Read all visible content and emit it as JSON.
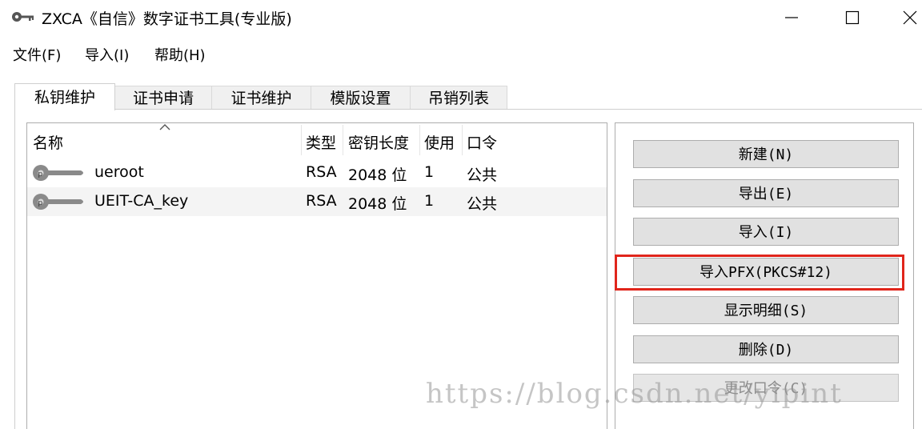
{
  "window": {
    "title": "ZXCA《自信》数字证书工具(专业版)",
    "icon": "key-icon"
  },
  "menu": [
    {
      "label": "文件(F)"
    },
    {
      "label": "导入(I)"
    },
    {
      "label": "帮助(H)"
    }
  ],
  "tabs": [
    {
      "label": "私钥维护",
      "active": true
    },
    {
      "label": "证书申请",
      "active": false
    },
    {
      "label": "证书维护",
      "active": false
    },
    {
      "label": "模版设置",
      "active": false
    },
    {
      "label": "吊销列表",
      "active": false
    }
  ],
  "list": {
    "columns": [
      "名称",
      "类型",
      "密钥长度",
      "使用",
      "口令"
    ],
    "rows": [
      {
        "name": "ueroot",
        "type": "RSA",
        "length": "2048 位",
        "use": "1",
        "password": "公共"
      },
      {
        "name": "UEIT-CA_key",
        "type": "RSA",
        "length": "2048 位",
        "use": "1",
        "password": "公共"
      }
    ]
  },
  "actions": [
    {
      "label": "新建(N)",
      "enabled": true
    },
    {
      "label": "导出(E)",
      "enabled": true
    },
    {
      "label": "导入(I)",
      "enabled": true
    },
    {
      "label": "导入PFX(PKCS#12)",
      "enabled": true,
      "highlighted": true
    },
    {
      "label": "显示明细(S)",
      "enabled": true
    },
    {
      "label": "删除(D)",
      "enabled": true
    },
    {
      "label": "更改口令(C)",
      "enabled": false
    }
  ],
  "watermark": "https://blog.csdn.net/yipint"
}
